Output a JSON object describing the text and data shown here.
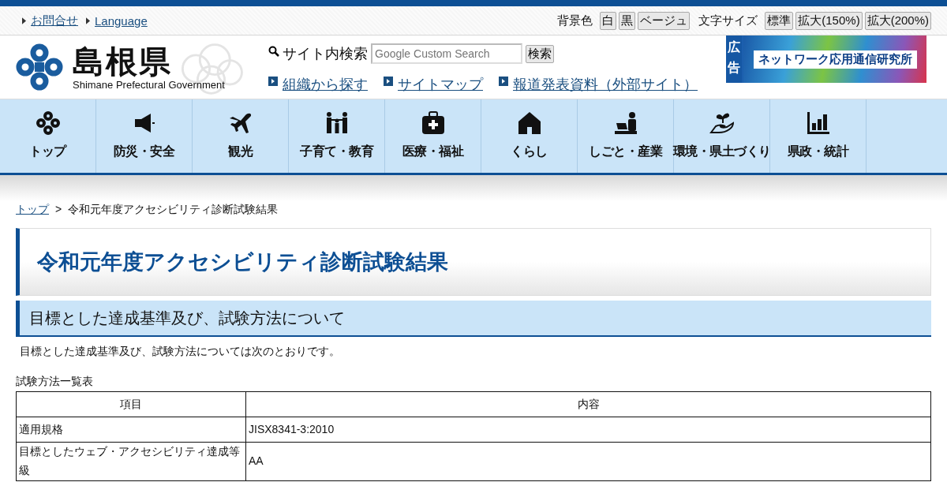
{
  "utility_links": [
    "お問合せ",
    "Language"
  ],
  "background_color": {
    "label": "背景色",
    "options": [
      "白",
      "黒",
      "ベージュ"
    ]
  },
  "text_size": {
    "label": "文字サイズ",
    "options": [
      "標準",
      "拡大(150%)",
      "拡大(200%)"
    ]
  },
  "logo": {
    "name": "島根県",
    "subtitle": "Shimane Prefectural Government"
  },
  "search": {
    "label": "サイト内検索",
    "placeholder": "Google Custom Search",
    "button": "検索"
  },
  "header_links": [
    "組織から探す",
    "サイトマップ",
    "報道発表資料（外部サイト）"
  ],
  "ad": {
    "badge": "広告",
    "text": "ネットワーク応用通信研究所"
  },
  "nav": [
    "トップ",
    "防災・安全",
    "観光",
    "子育て・教育",
    "医療・福祉",
    "くらし",
    "しごと・産業",
    "環境・県土づくり",
    "県政・統計"
  ],
  "breadcrumb": {
    "link": "トップ",
    "separator": ">",
    "current": "令和元年度アクセシビリティ診断試験結果"
  },
  "title": "令和元年度アクセシビリティ診断試験結果",
  "section_heading": "目標とした達成基準及び、試験方法について",
  "intro": "目標とした達成基準及び、試験方法については次のとおりです。",
  "table": {
    "caption": "試験方法一覧表",
    "columns": [
      "項目",
      "内容"
    ],
    "rows": [
      [
        "適用規格",
        "JISX8341-3:2010"
      ],
      [
        "目標としたウェブ・アクセシビリティ達成等級",
        "AA"
      ]
    ]
  }
}
